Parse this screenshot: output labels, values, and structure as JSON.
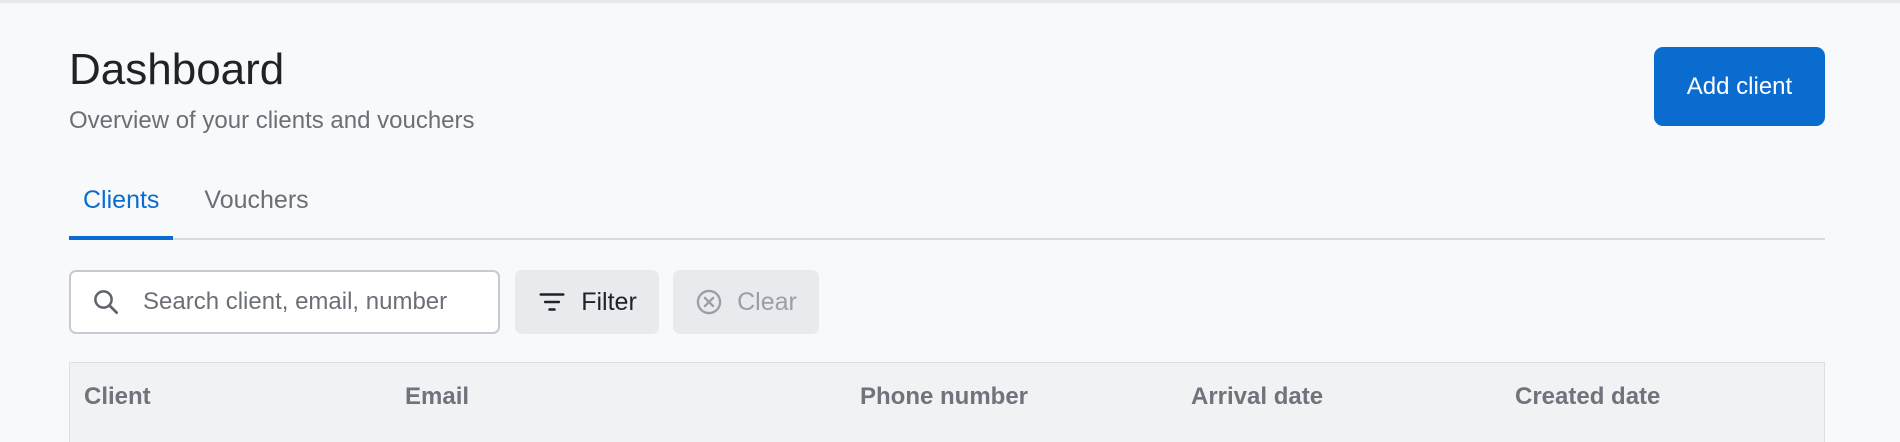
{
  "header": {
    "title": "Dashboard",
    "subtitle": "Overview of your clients and vouchers"
  },
  "actions": {
    "add_client_label": "Add client"
  },
  "tabs": [
    {
      "label": "Clients",
      "active": true
    },
    {
      "label": "Vouchers",
      "active": false
    }
  ],
  "toolbar": {
    "search_placeholder": "Search client, email, number",
    "search_value": "",
    "filter_label": "Filter",
    "clear_label": "Clear"
  },
  "table": {
    "columns": [
      "Client",
      "Email",
      "Phone number",
      "Arrival date",
      "Created date"
    ]
  },
  "icons": {
    "search": "search-icon",
    "filter": "filter-icon",
    "clear": "clear-circle-icon"
  },
  "colors": {
    "accent": "#0a6ccf",
    "background": "#f8f9fb"
  }
}
